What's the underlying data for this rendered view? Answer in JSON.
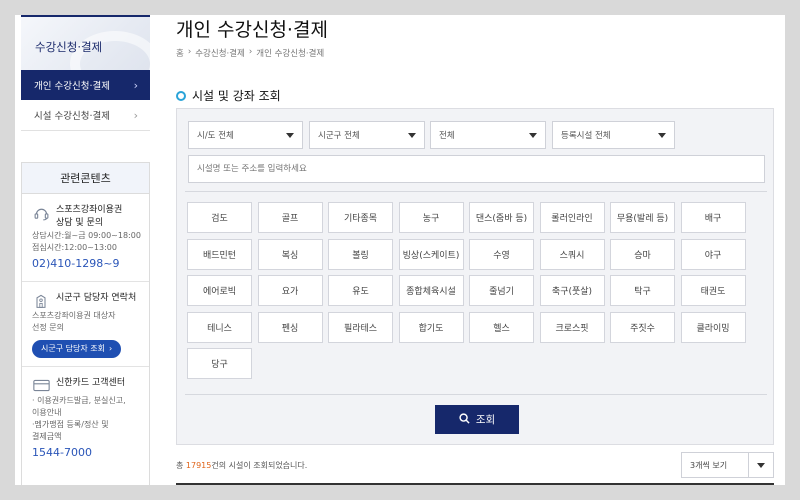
{
  "sidebar": {
    "title": "수강신청·결제",
    "items": [
      {
        "label": "개인 수강신청·결제",
        "chevron": "›"
      },
      {
        "label": "시설 수강신청·결제",
        "chevron": "›"
      }
    ],
    "related": {
      "title": "관련콘텐츠",
      "contact": {
        "icon": "headset-icon",
        "title_line1": "스포츠강좌이용권",
        "title_line2": "상담 및 문의",
        "hours_line1": "상담시간:월~금 09:00~18:00",
        "hours_line2": "점심시간:12:00~13:00",
        "phone": "02)410-1298~9"
      },
      "officer": {
        "icon": "building-icon",
        "title": "시군구 담당자 연락처",
        "desc_line1": "스포츠강좌이용권 대상자",
        "desc_line2": "선정 문의",
        "button": "시군구 담당자 조회",
        "button_arrow": "›"
      },
      "card": {
        "icon": "card-icon",
        "title": "신한카드 고객센터",
        "line1": "· 이용권카드발급, 분실신고,",
        "line2": "이용안내",
        "line3": "·멤가맹점 등록/정산 및",
        "line4": "결제금액",
        "phone": "1544-7000"
      }
    }
  },
  "main": {
    "title": "개인 수강신청·결제",
    "breadcrumb": [
      "홈",
      "›",
      "수강신청·결제",
      "›",
      "개인 수강신청·결제"
    ],
    "section_title": "시설 및 강좌 조회",
    "filters": {
      "sido": "시/도 전체",
      "sigungu": "시군구 전체",
      "category": "전체",
      "facility": "등록시설 전체"
    },
    "search_placeholder": "시설명 또는 주소를 입력하세요",
    "categories": [
      "검도",
      "골프",
      "기타종목",
      "농구",
      "댄스(줌바 등)",
      "롤러인라인",
      "무용(발레 등)",
      "배구",
      "배드민턴",
      "복싱",
      "볼링",
      "빙상(스케이트)",
      "수영",
      "스쿼시",
      "승마",
      "야구",
      "에어로빅",
      "요가",
      "유도",
      "종합체육시설",
      "줄넘기",
      "축구(풋살)",
      "탁구",
      "태권도",
      "테니스",
      "펜싱",
      "필라테스",
      "합기도",
      "헬스",
      "크로스핏",
      "주짓수",
      "클라이밍",
      "당구"
    ],
    "search_button": "조회",
    "results_prefix": "총 ",
    "results_count": "17915",
    "results_suffix": "건의 시설이 조회되었습니다.",
    "per_page": "3개씩 보기"
  }
}
